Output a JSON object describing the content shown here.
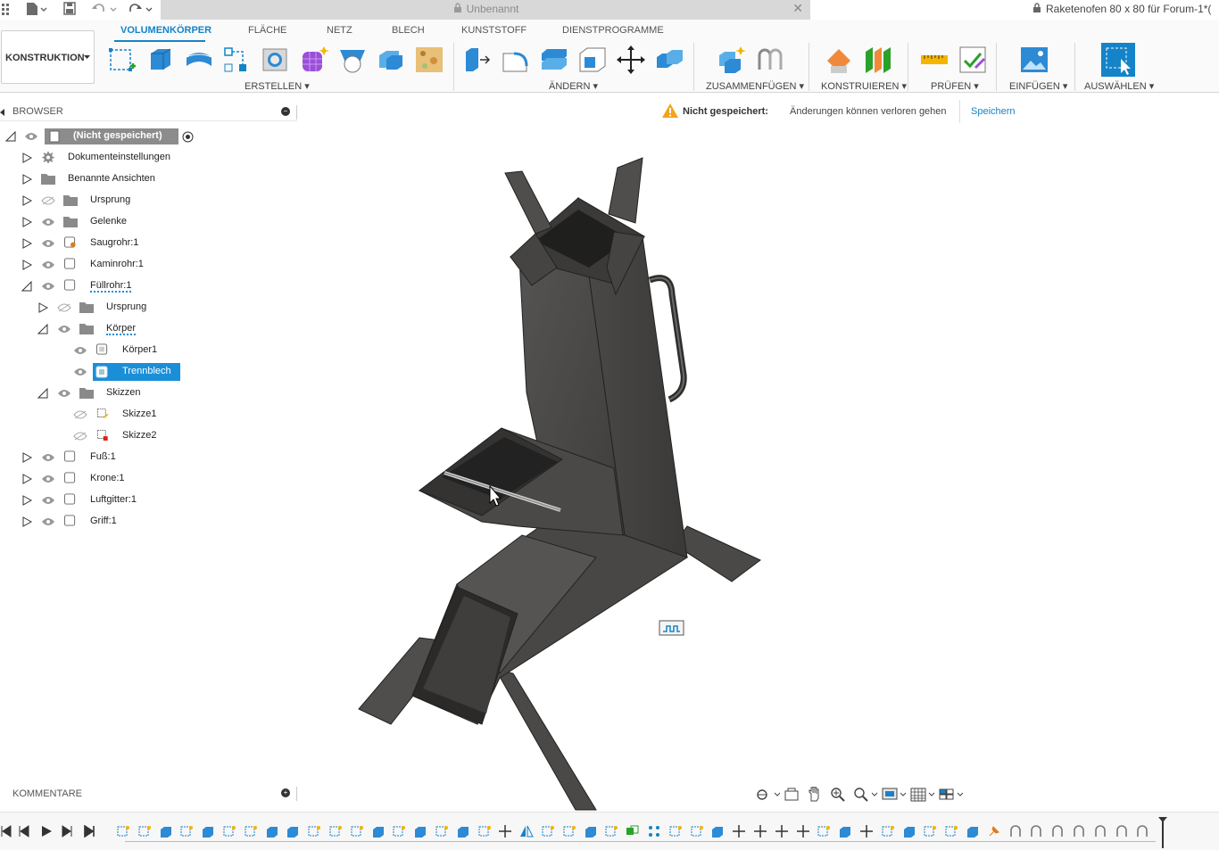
{
  "window": {
    "doc_tab_title": "Unbenannt",
    "right_doc_title": "Raketenofen 80 x 80 für Forum-1*(",
    "colors": {
      "accent": "#1583c8",
      "selection": "#1a8fd8",
      "warning": "#f2a419",
      "model": "#4a4947"
    }
  },
  "toolbar": {
    "workspace_label": "KONSTRUKTION",
    "tabs": [
      {
        "label": "VOLUMENKÖRPER",
        "active": true
      },
      {
        "label": "FLÄCHE"
      },
      {
        "label": "NETZ"
      },
      {
        "label": "BLECH"
      },
      {
        "label": "KUNSTSTOFF"
      },
      {
        "label": "DIENSTPROGRAMME"
      }
    ],
    "groups": [
      {
        "label": "ERSTELLEN"
      },
      {
        "label": "ÄNDERN"
      },
      {
        "label": "ZUSAMMENFÜGEN"
      },
      {
        "label": "KONSTRUIEREN"
      },
      {
        "label": "PRÜFEN"
      },
      {
        "label": "EINFÜGEN"
      },
      {
        "label": "AUSWÄHLEN"
      }
    ]
  },
  "browser": {
    "title": "BROWSER",
    "root": "(Nicht gespeichert)",
    "items": [
      {
        "label": "Dokumenteinstellungen"
      },
      {
        "label": "Benannte Ansichten"
      },
      {
        "label": "Ursprung"
      },
      {
        "label": "Gelenke"
      },
      {
        "label": "Saugrohr:1"
      },
      {
        "label": "Kaminrohr:1"
      },
      {
        "label": "Füllrohr:1"
      },
      {
        "label": "Ursprung"
      },
      {
        "label": "Körper"
      },
      {
        "label": "Körper1"
      },
      {
        "label": "Trennblech"
      },
      {
        "label": "Skizzen"
      },
      {
        "label": "Skizze1"
      },
      {
        "label": "Skizze2"
      },
      {
        "label": "Fuß:1"
      },
      {
        "label": "Krone:1"
      },
      {
        "label": "Luftgitter:1"
      },
      {
        "label": "Griff:1"
      }
    ]
  },
  "notice": {
    "status": "Nicht gespeichert:",
    "message": "Änderungen können verloren gehen",
    "action": "Speichern"
  },
  "comments": {
    "title": "KOMMENTARE"
  }
}
